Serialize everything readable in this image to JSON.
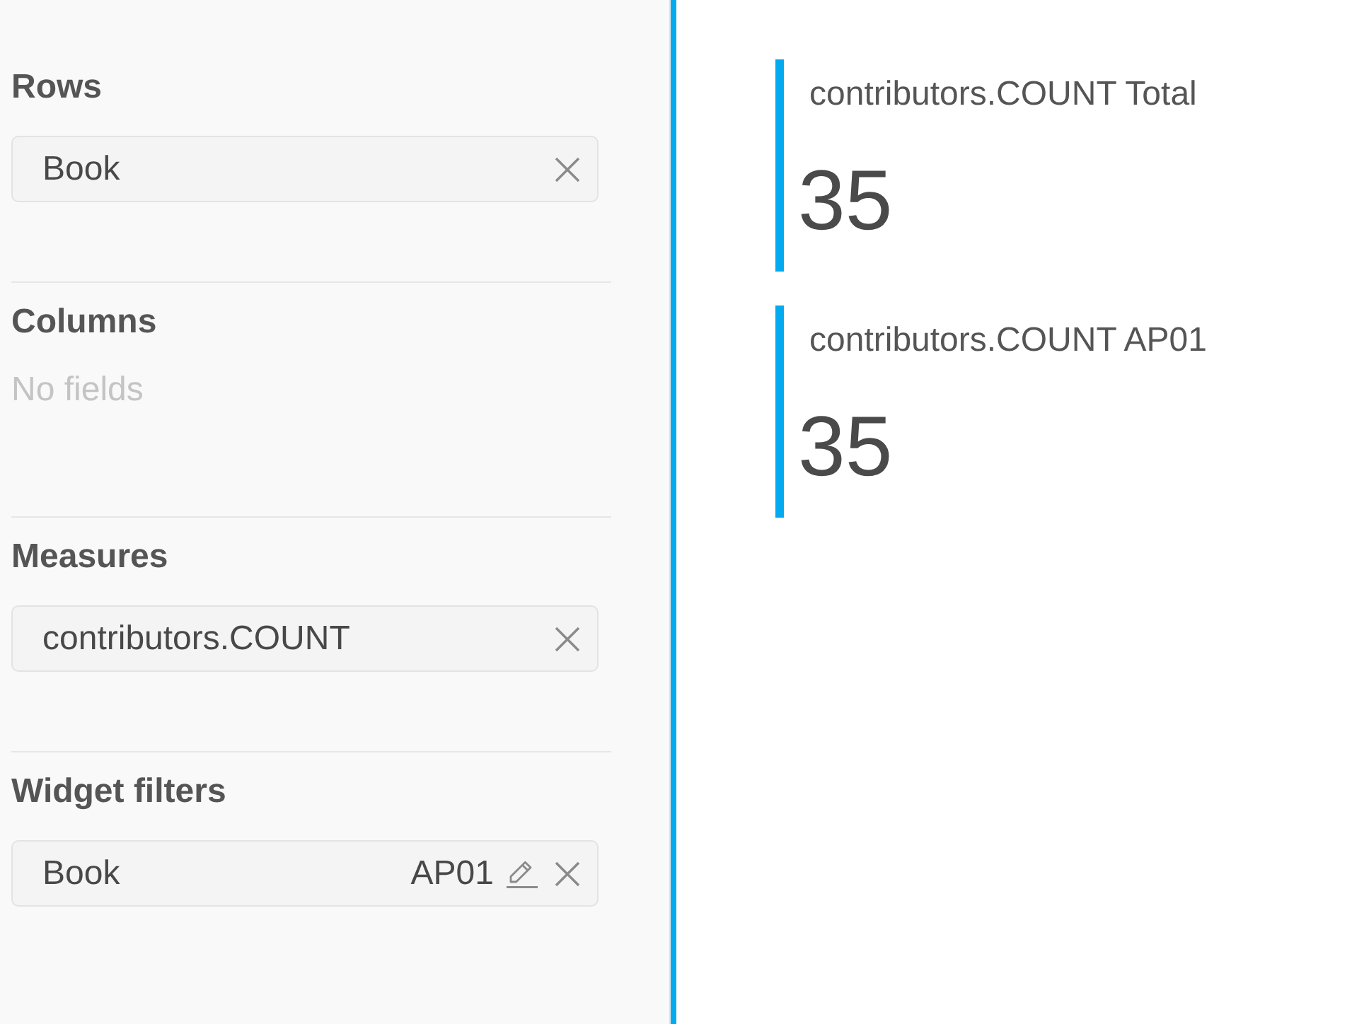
{
  "sidebar": {
    "sections": [
      {
        "title": "Rows",
        "chips": [
          {
            "label": "Book",
            "editable": false
          }
        ]
      },
      {
        "title": "Columns",
        "empty_text": "No fields"
      },
      {
        "title": "Measures",
        "chips": [
          {
            "label": "contributors.COUNT",
            "editable": false
          }
        ]
      },
      {
        "title": "Widget filters",
        "chips": [
          {
            "label": "Book",
            "value": "AP01",
            "editable": true
          }
        ]
      }
    ]
  },
  "kpis": [
    {
      "title": "contributors.COUNT Total",
      "value": "35"
    },
    {
      "title": "contributors.COUNT AP01",
      "value": "35"
    }
  ]
}
